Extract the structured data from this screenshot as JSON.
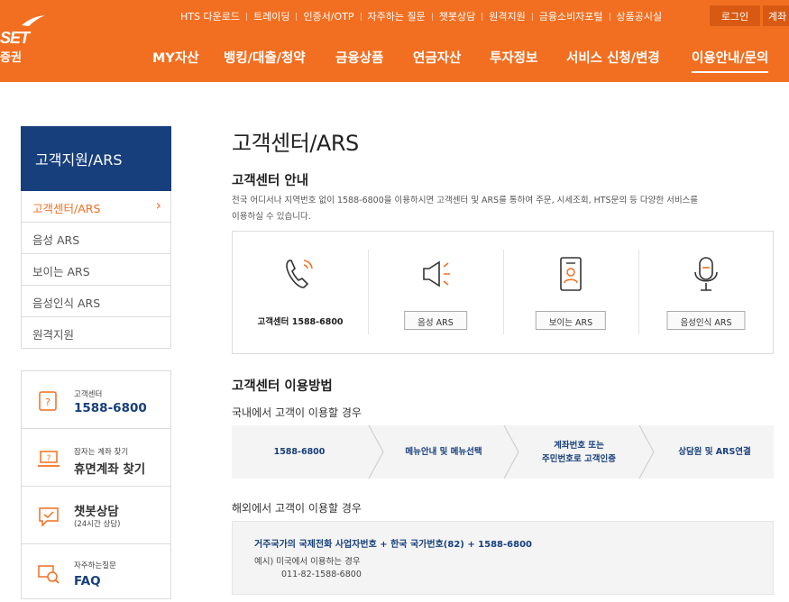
{
  "header": {
    "logo_text": "SET",
    "logo_sub": "증권",
    "util_links": [
      "HTS 다운로드",
      "트레이딩",
      "인증서/OTP",
      "자주하는 질문",
      "챗봇상담",
      "원격지원",
      "금융소비자포털",
      "상품공시실"
    ],
    "login_label": "로그인",
    "join_label": "계좌",
    "nav": [
      "MY자산",
      "뱅킹/대출/청약",
      "금융상품",
      "연금자산",
      "투자정보",
      "서비스 신청/변경",
      "이용안내/문의"
    ],
    "nav_active_index": 6,
    "brand_color": "#f26f21"
  },
  "sidebar": {
    "title": "고객지원/ARS",
    "items": [
      {
        "label": "고객센터/ARS",
        "active": true
      },
      {
        "label": "음성 ARS",
        "active": false
      },
      {
        "label": "보이는 ARS",
        "active": false
      },
      {
        "label": "음성인식 ARS",
        "active": false
      },
      {
        "label": "원격지원",
        "active": false
      }
    ]
  },
  "quick": [
    {
      "icon": "phone-question-icon",
      "small": "고객센터",
      "big": "1588-6800"
    },
    {
      "icon": "laptop-icon",
      "small": "잠자는 계좌 찾기",
      "big": "휴면계좌 찾기"
    },
    {
      "icon": "chat-check-icon",
      "big": "챗봇상담",
      "small": "(24시간 상담)"
    },
    {
      "icon": "faq-icon",
      "small": "자주하는질문",
      "big": "FAQ"
    }
  ],
  "main": {
    "title": "고객센터/ARS",
    "guide_heading": "고객센터 안내",
    "guide_desc": "전국 어디서나 지역번호 없이 1588-6800을 이용하시면 고객센터 및 ARS를 통하여 주문, 시세조회, HTS문의 등 다양한 서비스를 이용하실 수 있습니다.",
    "cards": [
      {
        "icon": "phone-ring-icon",
        "label": "고객센터 1588-6800",
        "type": "text"
      },
      {
        "icon": "speaker-icon",
        "label": "음성 ARS",
        "type": "button"
      },
      {
        "icon": "mobile-user-icon",
        "label": "보이는 ARS",
        "type": "button"
      },
      {
        "icon": "microphone-icon",
        "label": "음성인식 ARS",
        "type": "button"
      }
    ],
    "usage_heading": "고객센터 이용방법",
    "domestic_heading": "국내에서 고객이 이용할 경우",
    "steps": [
      "1588-6800",
      "메뉴안내 및 메뉴선택",
      "계좌번호 또는\n주민번호로 고객인증",
      "상담원 및 ARS연결"
    ],
    "abroad_heading": "해외에서 고객이 이용할 경우",
    "abroad_formula": "거주국가의 국제전화 사업자번호 + 한국 국가번호(82) + 1588-6800",
    "abroad_example_label": "예시) 미국에서 이용하는 경우",
    "abroad_example_number": "011-82-1588-6800"
  }
}
